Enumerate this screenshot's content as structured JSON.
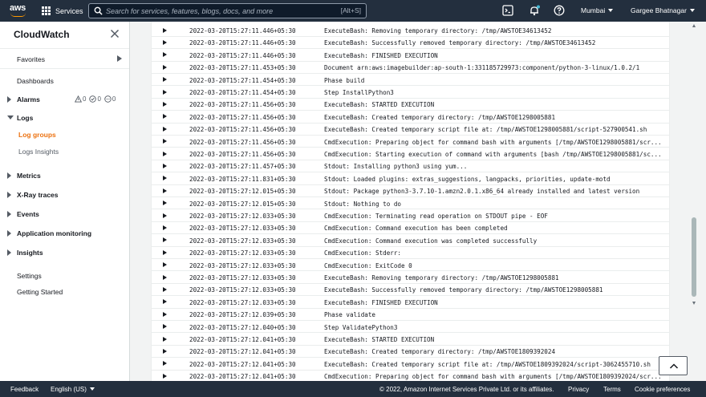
{
  "topnav": {
    "logo_text": "aws",
    "services_label": "Services",
    "search_placeholder": "Search for services, features, blogs, docs, and more",
    "search_shortcut": "[Alt+S]",
    "region": "Mumbai",
    "account": "Gargee Bhatnagar"
  },
  "sidebar": {
    "title": "CloudWatch",
    "favorites": "Favorites",
    "dashboards": "Dashboards",
    "alarms": "Alarms",
    "alarm_counts": {
      "alarm": "0",
      "ok": "0",
      "insufficient": "0"
    },
    "logs": "Logs",
    "log_groups": "Log groups",
    "logs_insights": "Logs Insights",
    "metrics": "Metrics",
    "xray": "X-Ray traces",
    "events": "Events",
    "app_monitoring": "Application monitoring",
    "insights": "Insights",
    "settings": "Settings",
    "getting_started": "Getting Started"
  },
  "log_rows": [
    {
      "ts": "2022-03-20T15:27:11.446+05:30",
      "msg": "ExecuteBash: Removing temporary directory: /tmp/AWSTOE34613452"
    },
    {
      "ts": "2022-03-20T15:27:11.446+05:30",
      "msg": "ExecuteBash: Successfully removed temporary directory: /tmp/AWSTOE34613452"
    },
    {
      "ts": "2022-03-20T15:27:11.446+05:30",
      "msg": "ExecuteBash: FINISHED EXECUTION"
    },
    {
      "ts": "2022-03-20T15:27:11.453+05:30",
      "msg": "Document arn:aws:imagebuilder:ap-south-1:331185729973:component/python-3-linux/1.0.2/1"
    },
    {
      "ts": "2022-03-20T15:27:11.454+05:30",
      "msg": "Phase build"
    },
    {
      "ts": "2022-03-20T15:27:11.454+05:30",
      "msg": "Step InstallPython3"
    },
    {
      "ts": "2022-03-20T15:27:11.456+05:30",
      "msg": "ExecuteBash: STARTED EXECUTION"
    },
    {
      "ts": "2022-03-20T15:27:11.456+05:30",
      "msg": "ExecuteBash: Created temporary directory: /tmp/AWSTOE1298005881"
    },
    {
      "ts": "2022-03-20T15:27:11.456+05:30",
      "msg": "ExecuteBash: Created temporary script file at: /tmp/AWSTOE1298005881/script-527900541.sh"
    },
    {
      "ts": "2022-03-20T15:27:11.456+05:30",
      "msg": "CmdExecution: Preparing object for command bash with arguments [/tmp/AWSTOE1298005881/scr..."
    },
    {
      "ts": "2022-03-20T15:27:11.456+05:30",
      "msg": "CmdExecution: Starting execution of command with arguments [bash /tmp/AWSTOE1298005881/sc..."
    },
    {
      "ts": "2022-03-20T15:27:11.457+05:30",
      "msg": "Stdout: Installing python3 using yum..."
    },
    {
      "ts": "2022-03-20T15:27:11.831+05:30",
      "msg": "Stdout: Loaded plugins: extras_suggestions, langpacks, priorities, update-motd"
    },
    {
      "ts": "2022-03-20T15:27:12.015+05:30",
      "msg": "Stdout: Package python3-3.7.10-1.amzn2.0.1.x86_64 already installed and latest version"
    },
    {
      "ts": "2022-03-20T15:27:12.015+05:30",
      "msg": "Stdout: Nothing to do"
    },
    {
      "ts": "2022-03-20T15:27:12.033+05:30",
      "msg": "CmdExecution: Terminating read operation on STDOUT pipe - EOF"
    },
    {
      "ts": "2022-03-20T15:27:12.033+05:30",
      "msg": "CmdExecution: Command execution has been completed"
    },
    {
      "ts": "2022-03-20T15:27:12.033+05:30",
      "msg": "CmdExecution: Command execution was completed successfully"
    },
    {
      "ts": "2022-03-20T15:27:12.033+05:30",
      "msg": "CmdExecution: Stderr:"
    },
    {
      "ts": "2022-03-20T15:27:12.033+05:30",
      "msg": "CmdExecution: ExitCode 0"
    },
    {
      "ts": "2022-03-20T15:27:12.033+05:30",
      "msg": "ExecuteBash: Removing temporary directory: /tmp/AWSTOE1298005881"
    },
    {
      "ts": "2022-03-20T15:27:12.033+05:30",
      "msg": "ExecuteBash: Successfully removed temporary directory: /tmp/AWSTOE1298005881"
    },
    {
      "ts": "2022-03-20T15:27:12.033+05:30",
      "msg": "ExecuteBash: FINISHED EXECUTION"
    },
    {
      "ts": "2022-03-20T15:27:12.039+05:30",
      "msg": "Phase validate"
    },
    {
      "ts": "2022-03-20T15:27:12.040+05:30",
      "msg": "Step ValidatePython3"
    },
    {
      "ts": "2022-03-20T15:27:12.041+05:30",
      "msg": "ExecuteBash: STARTED EXECUTION"
    },
    {
      "ts": "2022-03-20T15:27:12.041+05:30",
      "msg": "ExecuteBash: Created temporary directory: /tmp/AWSTOE1809392024"
    },
    {
      "ts": "2022-03-20T15:27:12.041+05:30",
      "msg": "ExecuteBash: Created temporary script file at: /tmp/AWSTOE1809392024/script-3062455710.sh"
    },
    {
      "ts": "2022-03-20T15:27:12.041+05:30",
      "msg": "CmdExecution: Preparing object for command bash with arguments [/tmp/AWSTOE1809392024/scr..."
    }
  ],
  "footer": {
    "feedback": "Feedback",
    "language": "English (US)",
    "copyright": "© 2022, Amazon Internet Services Private Ltd. or its affiliates.",
    "privacy": "Privacy",
    "terms": "Terms",
    "cookies": "Cookie preferences"
  },
  "colors": {
    "nav_bg": "#232f3e",
    "accent": "#ec7211",
    "smile": "#ff9900"
  }
}
